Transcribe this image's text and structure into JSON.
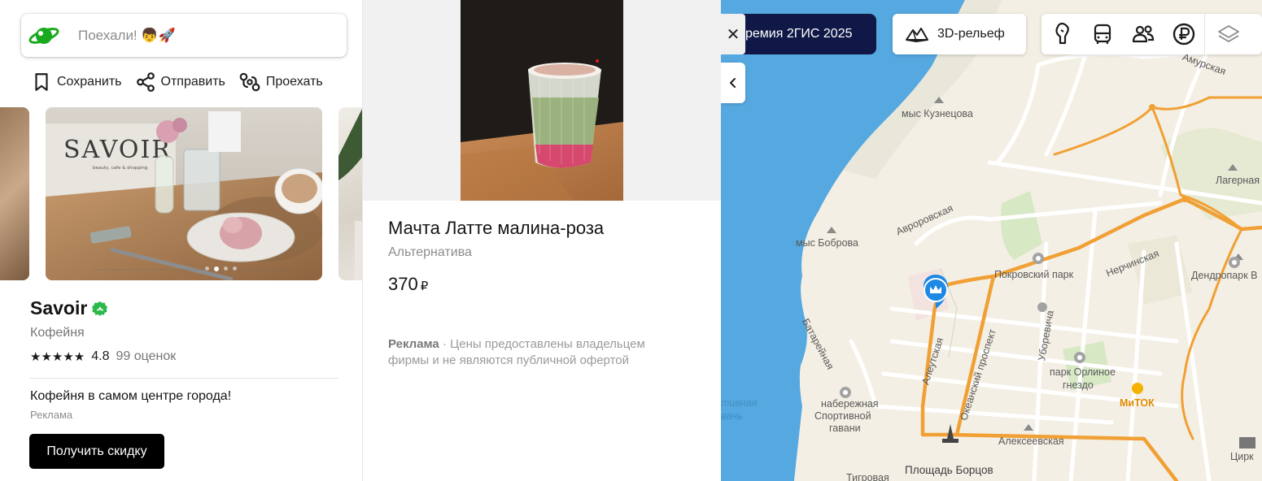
{
  "search": {
    "placeholder": "Поехали! 👦🚀"
  },
  "actions": {
    "save": "Сохранить",
    "share": "Отправить",
    "route": "Проехать"
  },
  "gallery": {
    "main_photo_sign": "SAVOIR",
    "main_photo_subtitle": "beauty, cafe & shopping",
    "dots_count": 4,
    "active_dot": 1
  },
  "firm": {
    "name": "Savoir",
    "category": "Кофейня",
    "stars": "★★★★★",
    "rating": "4.8",
    "reviews": "99 оценок",
    "promo_text": "Кофейня в самом центре города!",
    "promo_label": "Реклама",
    "discount_button": "Получить скидку"
  },
  "product": {
    "title": "Мачта Латте малина-роза",
    "subtitle": "Альтернатива",
    "price": "370",
    "currency": "₽",
    "ad_label": "Реклама",
    "separator": "·",
    "disclaimer": "Цены предоставлены владельцем фирмы и не являются публичной офертой"
  },
  "map": {
    "banner": "ремия 2ГИС 2025",
    "close_symbol": "✕",
    "relief_button": "3D-рельеф",
    "toolbar_icons": [
      "sightseeing-icon",
      "transport-icon",
      "friends-icon",
      "currency-icon",
      "layers-icon"
    ],
    "labels": {
      "amurskaya": "Амурская",
      "mys_kuznetsova": "мыс Кузнецова",
      "lagernaya": "Лагерная",
      "avrorovskaya": "Авроровская",
      "mys_bobrova": "мыс Боброва",
      "pokrovsky_park": "Покровский парк",
      "nerchinskaya": "Нерчинская",
      "dendropark": "Дендропарк В",
      "batareynaya": "Батарейная",
      "aleutskaya": "Алеутская",
      "okeansky": "Океанский проспект",
      "uborevicha": "Уборевича",
      "park_orlinoe_1": "парк Орлиное",
      "park_orlinoe_2": "гнездо",
      "mitok": "МиТОК",
      "sport_gavan_water_1": "тивная",
      "sport_gavan_water_2": "вань",
      "naberezhnaya_1": "набережная",
      "naberezhnaya_2": "Спортивной",
      "naberezhnaya_3": "гавани",
      "alekseevskaya": "Алексеевская",
      "circus": "Цирк",
      "ploshad": "Площадь Борцов",
      "tigrovaya": "Тигровая"
    },
    "colors": {
      "water": "#56a8e0",
      "land": "#f4efe4",
      "route": "#f5a623",
      "banner": "#0f1846",
      "pin": "#1e88e5"
    }
  }
}
